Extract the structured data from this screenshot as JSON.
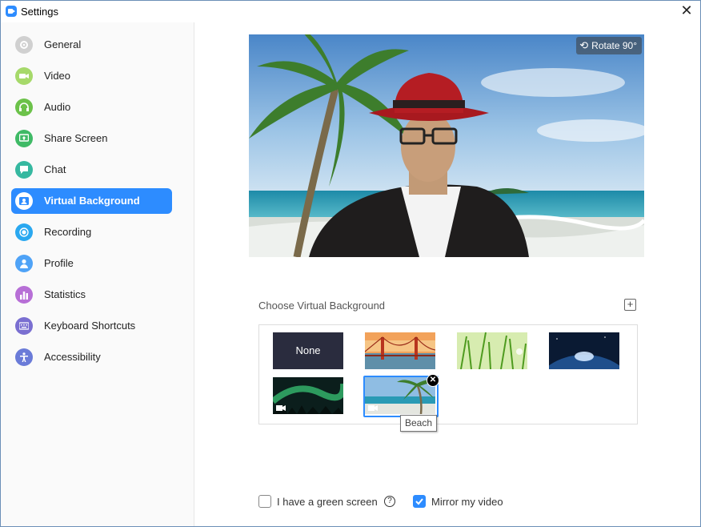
{
  "window": {
    "title": "Settings",
    "close_glyph": "✕"
  },
  "sidebar": {
    "items": [
      {
        "label": "General",
        "icon": "gear-icon",
        "color": "#d0d0d0",
        "active": false
      },
      {
        "label": "Video",
        "icon": "video-icon",
        "color": "#a6d96a",
        "active": false
      },
      {
        "label": "Audio",
        "icon": "headphones-icon",
        "color": "#6cc24a",
        "active": false
      },
      {
        "label": "Share Screen",
        "icon": "share-screen-icon",
        "color": "#3fba66",
        "active": false
      },
      {
        "label": "Chat",
        "icon": "chat-icon",
        "color": "#36b8a0",
        "active": false
      },
      {
        "label": "Virtual Background",
        "icon": "person-card-icon",
        "color": "#2d8cff",
        "active": true
      },
      {
        "label": "Recording",
        "icon": "record-icon",
        "color": "#2aa8f0",
        "active": false
      },
      {
        "label": "Profile",
        "icon": "profile-icon",
        "color": "#4fa3f7",
        "active": false
      },
      {
        "label": "Statistics",
        "icon": "bar-chart-icon",
        "color": "#b76fd6",
        "active": false
      },
      {
        "label": "Keyboard Shortcuts",
        "icon": "keyboard-icon",
        "color": "#7a6fd1",
        "active": false
      },
      {
        "label": "Accessibility",
        "icon": "accessibility-icon",
        "color": "#6a7bd8",
        "active": false
      }
    ]
  },
  "preview": {
    "rotate_label": "Rotate 90°",
    "rotate_icon": "rotate-icon"
  },
  "gallery": {
    "title": "Choose Virtual Background",
    "add_glyph": "+",
    "none_label": "None",
    "thumbnails": [
      {
        "kind": "none"
      },
      {
        "kind": "golden-gate"
      },
      {
        "kind": "grass"
      },
      {
        "kind": "earth"
      },
      {
        "kind": "aurora",
        "video": true
      },
      {
        "kind": "beach",
        "video": true,
        "selected": true
      }
    ],
    "hover_tooltip": "Beach",
    "remove_glyph": "✕"
  },
  "options": {
    "green_screen_label": "I have a green screen",
    "green_screen_checked": false,
    "mirror_label": "Mirror my video",
    "mirror_checked": true,
    "help_glyph": "?"
  },
  "colors": {
    "accent": "#2d8cff",
    "active_text": "#ffffff"
  }
}
